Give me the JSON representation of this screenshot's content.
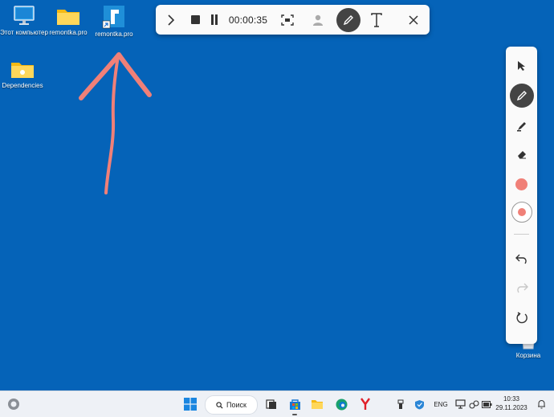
{
  "desktop": {
    "icons": [
      {
        "label": "Этот компьютер",
        "icon": "monitor-icon"
      },
      {
        "label": "remontka.pro",
        "icon": "folder-icon"
      },
      {
        "label": "remontka.pro",
        "icon": "shortcut-icon"
      },
      {
        "label": "Dependencies",
        "icon": "folder-icon"
      },
      {
        "label": "Корзина",
        "icon": "recycle-bin-icon"
      }
    ]
  },
  "recorder": {
    "timer": "00:00:35",
    "buttons": [
      "expand",
      "stop",
      "pause",
      "screen-region",
      "camera",
      "pen",
      "text",
      "close"
    ]
  },
  "annotation_panel": {
    "tools": [
      "select",
      "pen",
      "highlighter",
      "eraser",
      "color",
      "thickness",
      "undo",
      "redo",
      "clear"
    ],
    "color": "#f08078"
  },
  "taskbar": {
    "search_label": "Поиск",
    "language": "ENG",
    "time": "10:33",
    "date": "29.11.2023"
  },
  "colors": {
    "desktop_bg": "#0563b8",
    "annotation": "#f08078",
    "toolbar_bg": "#fafafa"
  }
}
